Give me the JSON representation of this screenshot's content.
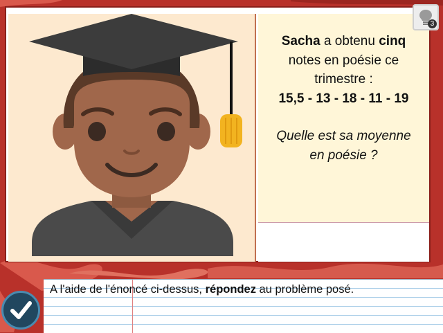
{
  "problem": {
    "line1_name": "Sacha",
    "line1_rest": " a obtenu ",
    "line1_count": "cinq",
    "line2": "notes en poésie ce",
    "line3": "trimestre :",
    "grades": "15,5 - 13 - 18 - 11 - 19",
    "question_line1": "Quelle est sa moyenne",
    "question_line2": "en poésie ?"
  },
  "hint": {
    "icon": "lightbulb-icon",
    "count": "3"
  },
  "instruction": {
    "prefix": "A l'aide de l'énoncé ci-dessus, ",
    "bold": "répondez",
    "suffix": " au problème posé."
  },
  "validate": {
    "icon": "checkmark-icon"
  },
  "colors": {
    "background": "#b8312a",
    "panel_cream": "#fde9cf",
    "text_panel": "#fff6d8",
    "button": "#21475f"
  },
  "illustration": {
    "icon": "graduate-student-icon"
  }
}
